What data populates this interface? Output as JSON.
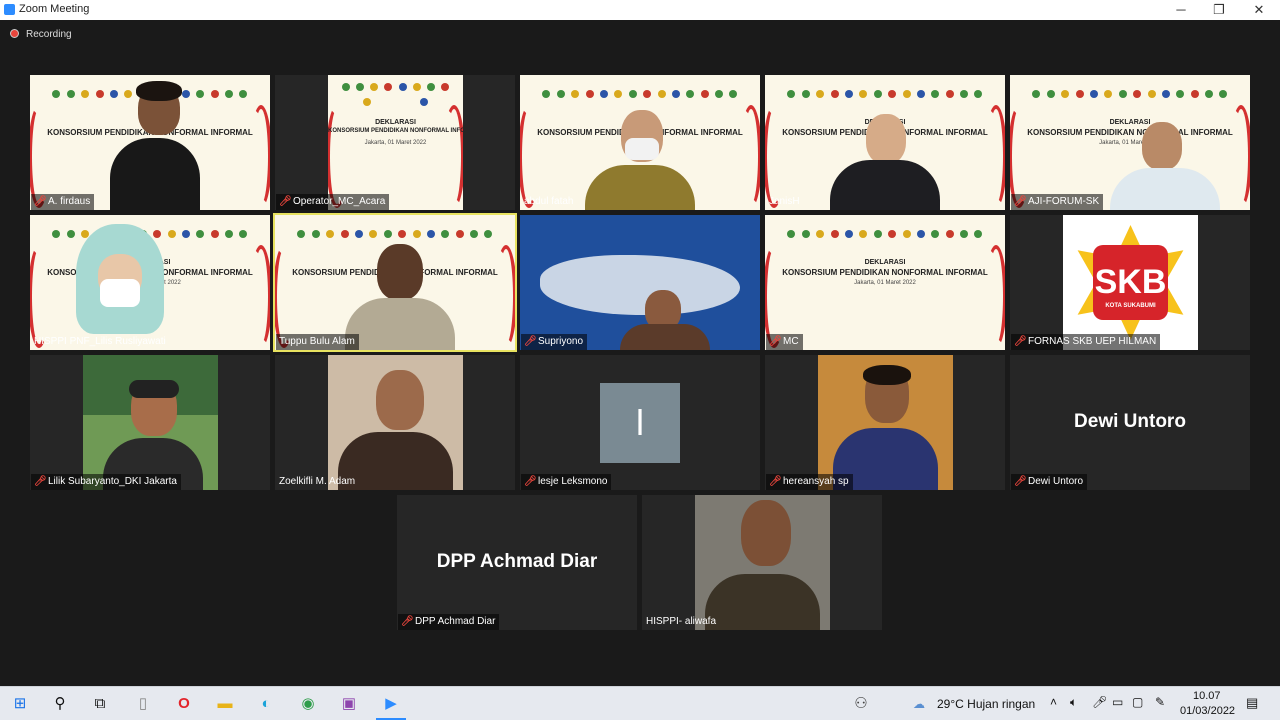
{
  "window": {
    "title": "Zoom Meeting",
    "minimize": "─",
    "maximize": "❐",
    "close": "✕"
  },
  "recording": {
    "label": "Recording"
  },
  "tiles": [
    {
      "name": "A. firdaus"
    },
    {
      "name": "Operator_MC_Acara"
    },
    {
      "name": "abdul fatah"
    },
    {
      "name": "JanisH"
    },
    {
      "name": "AJI-FORUM-SK"
    },
    {
      "name": "HISPPI PNF_Lilis Rusliyawati"
    },
    {
      "name": "Tuppu Bulu Alam"
    },
    {
      "name": "Supriyono"
    },
    {
      "name": "MC"
    },
    {
      "name": "FORNAS SKB UEP HILMAN"
    },
    {
      "name": "Lilik Subaryanto_DKI Jakarta"
    },
    {
      "name": "Zoelkifli M. Adam"
    },
    {
      "name": "lesje Leksmono",
      "initial": "l"
    },
    {
      "name": "hereansyah sp"
    },
    {
      "name": "Dewi Untoro",
      "display": "Dewi Untoro"
    },
    {
      "name": "DPP Achmad Diar",
      "display": "DPP Achmad Diar"
    },
    {
      "name": "HISPPI- aliwafa"
    }
  ],
  "banner": {
    "deklarasi": "DEKLARASI",
    "konsorsium": "KONSORSIUM PENDIDIKAN NONFORMAL INFORMAL",
    "date": "Jakarta, 01 Maret 2022"
  },
  "skb_logo": {
    "text": "SKB",
    "subtext": "KOTA SUKABUMI"
  },
  "taskbar": {
    "weather": "29°C  Hujan ringan",
    "time": "10.07",
    "date": "01/03/2022"
  },
  "colors": {
    "accent": "#2d8cff",
    "active_speaker": "#e8e360",
    "muted": "#e8453c"
  }
}
